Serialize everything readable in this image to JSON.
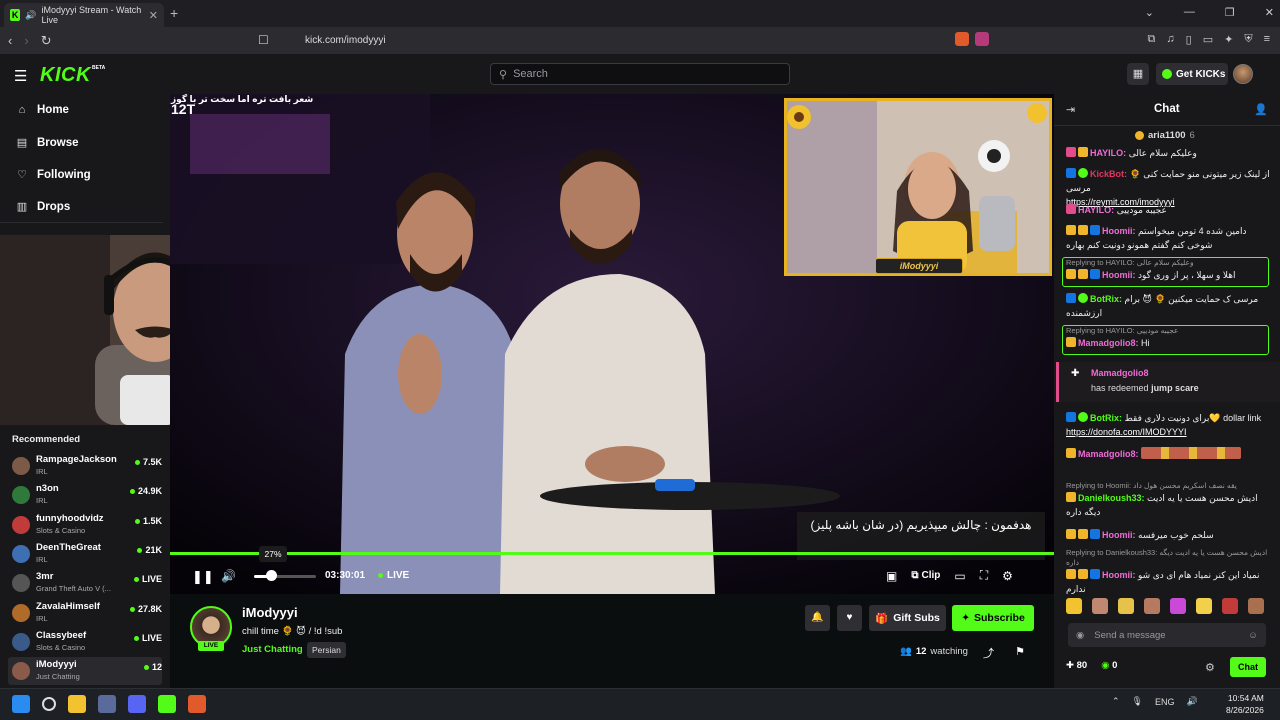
{
  "browser": {
    "tab_title": "iModyyyi Stream - Watch Live",
    "url": "kick.com/imodyyyi"
  },
  "topbar": {
    "logo": "KICK",
    "beta": "BETA",
    "search_placeholder": "Search",
    "get_kicks": "Get KICKs"
  },
  "sidebar": {
    "nav": [
      "Home",
      "Browse",
      "Following",
      "Drops"
    ],
    "recommended_title": "Recommended",
    "recommended": [
      {
        "name": "RampageJackson",
        "category": "IRL",
        "viewers": "7.5K",
        "color": "#7b5a48"
      },
      {
        "name": "n3on",
        "category": "IRL",
        "viewers": "24.9K",
        "color": "#2f7a3a"
      },
      {
        "name": "funnyhoodvidz",
        "category": "Slots & Casino",
        "viewers": "1.5K",
        "color": "#c23b3b"
      },
      {
        "name": "DeenTheGreat",
        "category": "IRL",
        "viewers": "21K",
        "color": "#3d6fb2"
      },
      {
        "name": "3mr",
        "category": "Grand Theft Auto V (...",
        "viewers": "LIVE",
        "color": "#555"
      },
      {
        "name": "ZavalaHimself",
        "category": "IRL",
        "viewers": "27.8K",
        "color": "#b06a2a"
      },
      {
        "name": "Classybeef",
        "category": "Slots & Casino",
        "viewers": "LIVE",
        "color": "#3a5a8a"
      },
      {
        "name": "iModyyyi",
        "category": "Just Chatting",
        "viewers": "12",
        "color": "#8a5a4a"
      }
    ]
  },
  "video": {
    "overlay_title": "شعر بافت تره اما سخت تر با گوز",
    "overlay_number": "12T",
    "pip_name": "iModyyyi",
    "subtitle": "هدفمون : چالش میپذیریم (در شان باشه پلیز)",
    "volume_tooltip": "27%",
    "volume": 0.27,
    "progress": 1.0,
    "timecode": "03:30:01",
    "live_label": "LIVE",
    "clip_label": "Clip"
  },
  "channel": {
    "name": "iModyyyi",
    "title": "chill time 🌻 😈 / !d !sub",
    "category": "Just Chatting",
    "tag": "Persian",
    "live_pill": "LIVE",
    "gift_subs": "Gift Subs",
    "subscribe": "Subscribe",
    "watching_count": "12",
    "watching_label": "watching"
  },
  "chat": {
    "title": "Chat",
    "pinned_user": "aria1100",
    "pinned_count": "6",
    "messages": [
      {
        "user": "HAYILO:",
        "color": "#f06bd6",
        "text": "وعلیکم سلام عالی"
      },
      {
        "user": "KickBot:",
        "color": "#e4355f",
        "text": "از لینک زیر میتونی منو حمایت کنی 🌻 مرسی",
        "link": "https://reymit.com/imodyyyi"
      },
      {
        "user": "HAYILO:",
        "color": "#f06bd6",
        "text": "عجیبه مودییی"
      },
      {
        "user": "Hoomii:",
        "color": "#f06bd6",
        "text": "دامین شده 4 تومن میخواستم شوخی کنم گفتم همونو دونیت کنم بهاره"
      },
      {
        "reply": "Replying to HAYILO: وعلیکم سلام عالی",
        "user": "Hoomii:",
        "color": "#f06bd6",
        "text": "اهلا و سهلا ، پر از وری گود"
      },
      {
        "user": "BotRix:",
        "color": "#53fc18",
        "text": "مرسی ک حمایت میکنین 🌻 😈 برام ارزشمنده"
      },
      {
        "reply": "Replying to HAYILO: عجیبه مودییی",
        "user": "Mamadgolio8:",
        "color": "#f06bd6",
        "text": "Hi"
      },
      {
        "redeem_user": "Mamadgolio8",
        "redeem_text": "has redeemed",
        "redeem_item": "jump scare"
      },
      {
        "user": "BotRix:",
        "color": "#53fc18",
        "text": "برای دونیت دلاری فقط💛 dollar link",
        "link": "https://donofa.com/IMODYYYI"
      },
      {
        "user": "Mamadgolio8:",
        "color": "#f06bd6",
        "text": ""
      },
      {
        "reply": "Replying to Hoomii: یقه نصف اسکریم محسن هول داد",
        "user": "Danielkoush33:",
        "color": "#53fc18",
        "text": "ادیش محسن هست یا یه ادیت دیگه داره"
      },
      {
        "user": "Hoomii:",
        "color": "#f06bd6",
        "text": "سلحم خوب میرفسه"
      },
      {
        "reply": "Replying to Danielkoush33: ادیش محسن هست یا یه ادیت دیگه داره",
        "user": "Hoomii:",
        "color": "#f06bd6",
        "text": "نمیاد این کنر نمیاد هام ای دی شو ندارم"
      }
    ],
    "input_placeholder": "Send a message",
    "points": "80",
    "kicks": "0",
    "chat_button": "Chat"
  },
  "taskbar": {
    "lang": "ENG",
    "time": "10:54 AM",
    "date": "8/26/2026"
  }
}
